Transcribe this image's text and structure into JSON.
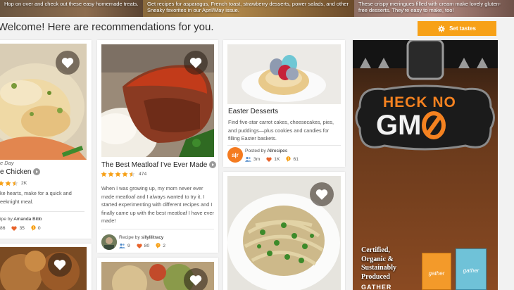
{
  "promo": {
    "items": [
      {
        "text": "Hop on over and check out these easy homemade treats."
      },
      {
        "text": "Get recipes for asparagus, French toast, strawberry desserts, power salads, and other Sneaky favorites in our April/May issue."
      },
      {
        "text": "These crispy meringues filled with cream make lovely gluten-free desserts. They're easy to make, too!"
      }
    ]
  },
  "header": {
    "welcome": "Welcome! Here are recommendations for you.",
    "set_tastes_label": "Set tastes"
  },
  "cards": {
    "chicken": {
      "kicker": "e Day",
      "title": "e Chicken",
      "ratings_count": "2K",
      "description_lines": [
        "ke hearts, make for a quick and",
        "eeknight meal."
      ],
      "by_label": "ipe by",
      "author": "Amanda Bibb",
      "made_count": "86",
      "loves_count": "35",
      "reviews_count": "0"
    },
    "meatloaf": {
      "title": "The Best Meatloaf I've Ever Made",
      "rating": 4.5,
      "ratings_count": "474",
      "description": "When I was growing up, my mom never ever made meatloaf and I always wanted to try it. I started experimenting with different recipes and I finally came up with the best meatloaf I have ever made!",
      "by_label": "Recipe by",
      "author": "sillylilitracy",
      "made_count": "9",
      "loves_count": "80",
      "reviews_count": "2"
    },
    "easter": {
      "title": "Easter Desserts",
      "description": "Find five-star carrot cakes, cheesecakes, pies, and puddings—plus cookies and candies for filling Easter baskets.",
      "by_label": "Posted by",
      "author": "Allrecipes",
      "avatar_text": "a|r",
      "made_count": "3m",
      "loves_count": "1K",
      "reviews_count": "61"
    }
  },
  "ad": {
    "tag_line1": "HECK NO",
    "tag_line2": "GM",
    "tagline_lines": [
      "Certified,",
      "Organic &",
      "Sustainably",
      "Produced"
    ],
    "bag_label": "gather",
    "footer": "GATHER"
  },
  "colors": {
    "accent": "#f7a118",
    "background": "#f2f2f2",
    "tag_orange": "#f58220"
  },
  "icons": {
    "heart": "heart-icon",
    "gear": "gear-icon",
    "play": "play-icon",
    "star": "star-icon",
    "made": "people-icon",
    "love": "heart-small-icon",
    "review": "comment-icon"
  }
}
